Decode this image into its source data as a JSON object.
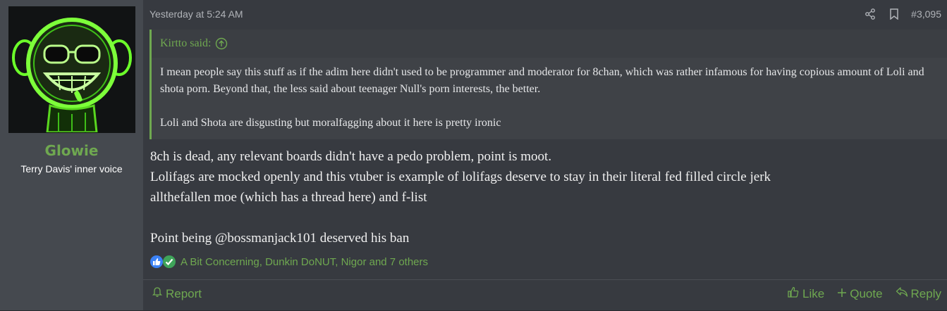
{
  "user": {
    "name": "Glowie",
    "title": "Terry Davis' inner voice",
    "avatar_icon": "glowing-smiley-avatar"
  },
  "post": {
    "date": "Yesterday at 5:24 AM",
    "number": "#3,095",
    "header_icons": [
      "share-icon",
      "bookmark-icon"
    ]
  },
  "quote": {
    "author_line": "Kirtto said:",
    "paragraphs": [
      "I mean people say this stuff as if the adim here didn't used to be programmer and moderator for 8chan, which was rather infamous for having copious amount of Loli and shota porn. Beyond that, the less said about teenager Null's porn interests, the better.",
      "Loli and Shota are disgusting but moralfagging about it here is pretty ironic"
    ]
  },
  "message": {
    "lines": [
      "8ch is dead, any relevant boards didn't have a pedo problem, point is moot.",
      "Lolifags are mocked openly and this vtuber is example of lolifags deserve to stay in their literal fed filled circle jerk",
      "allthefallen moe (which has a thread here) and f-list",
      "Point being @bossmanjack101 deserved his ban"
    ]
  },
  "reactions": {
    "text": "A Bit Concerning, Dunkin DoNUT, Nigor and 7 others",
    "icons": [
      "like-reaction-icon",
      "check-reaction-icon"
    ]
  },
  "footer": {
    "report": "Report",
    "like": "Like",
    "quote": "Quote",
    "reply": "Reply"
  },
  "colors": {
    "accent": "#6fa850",
    "background": "#373a40",
    "user_panel": "#45494f"
  }
}
